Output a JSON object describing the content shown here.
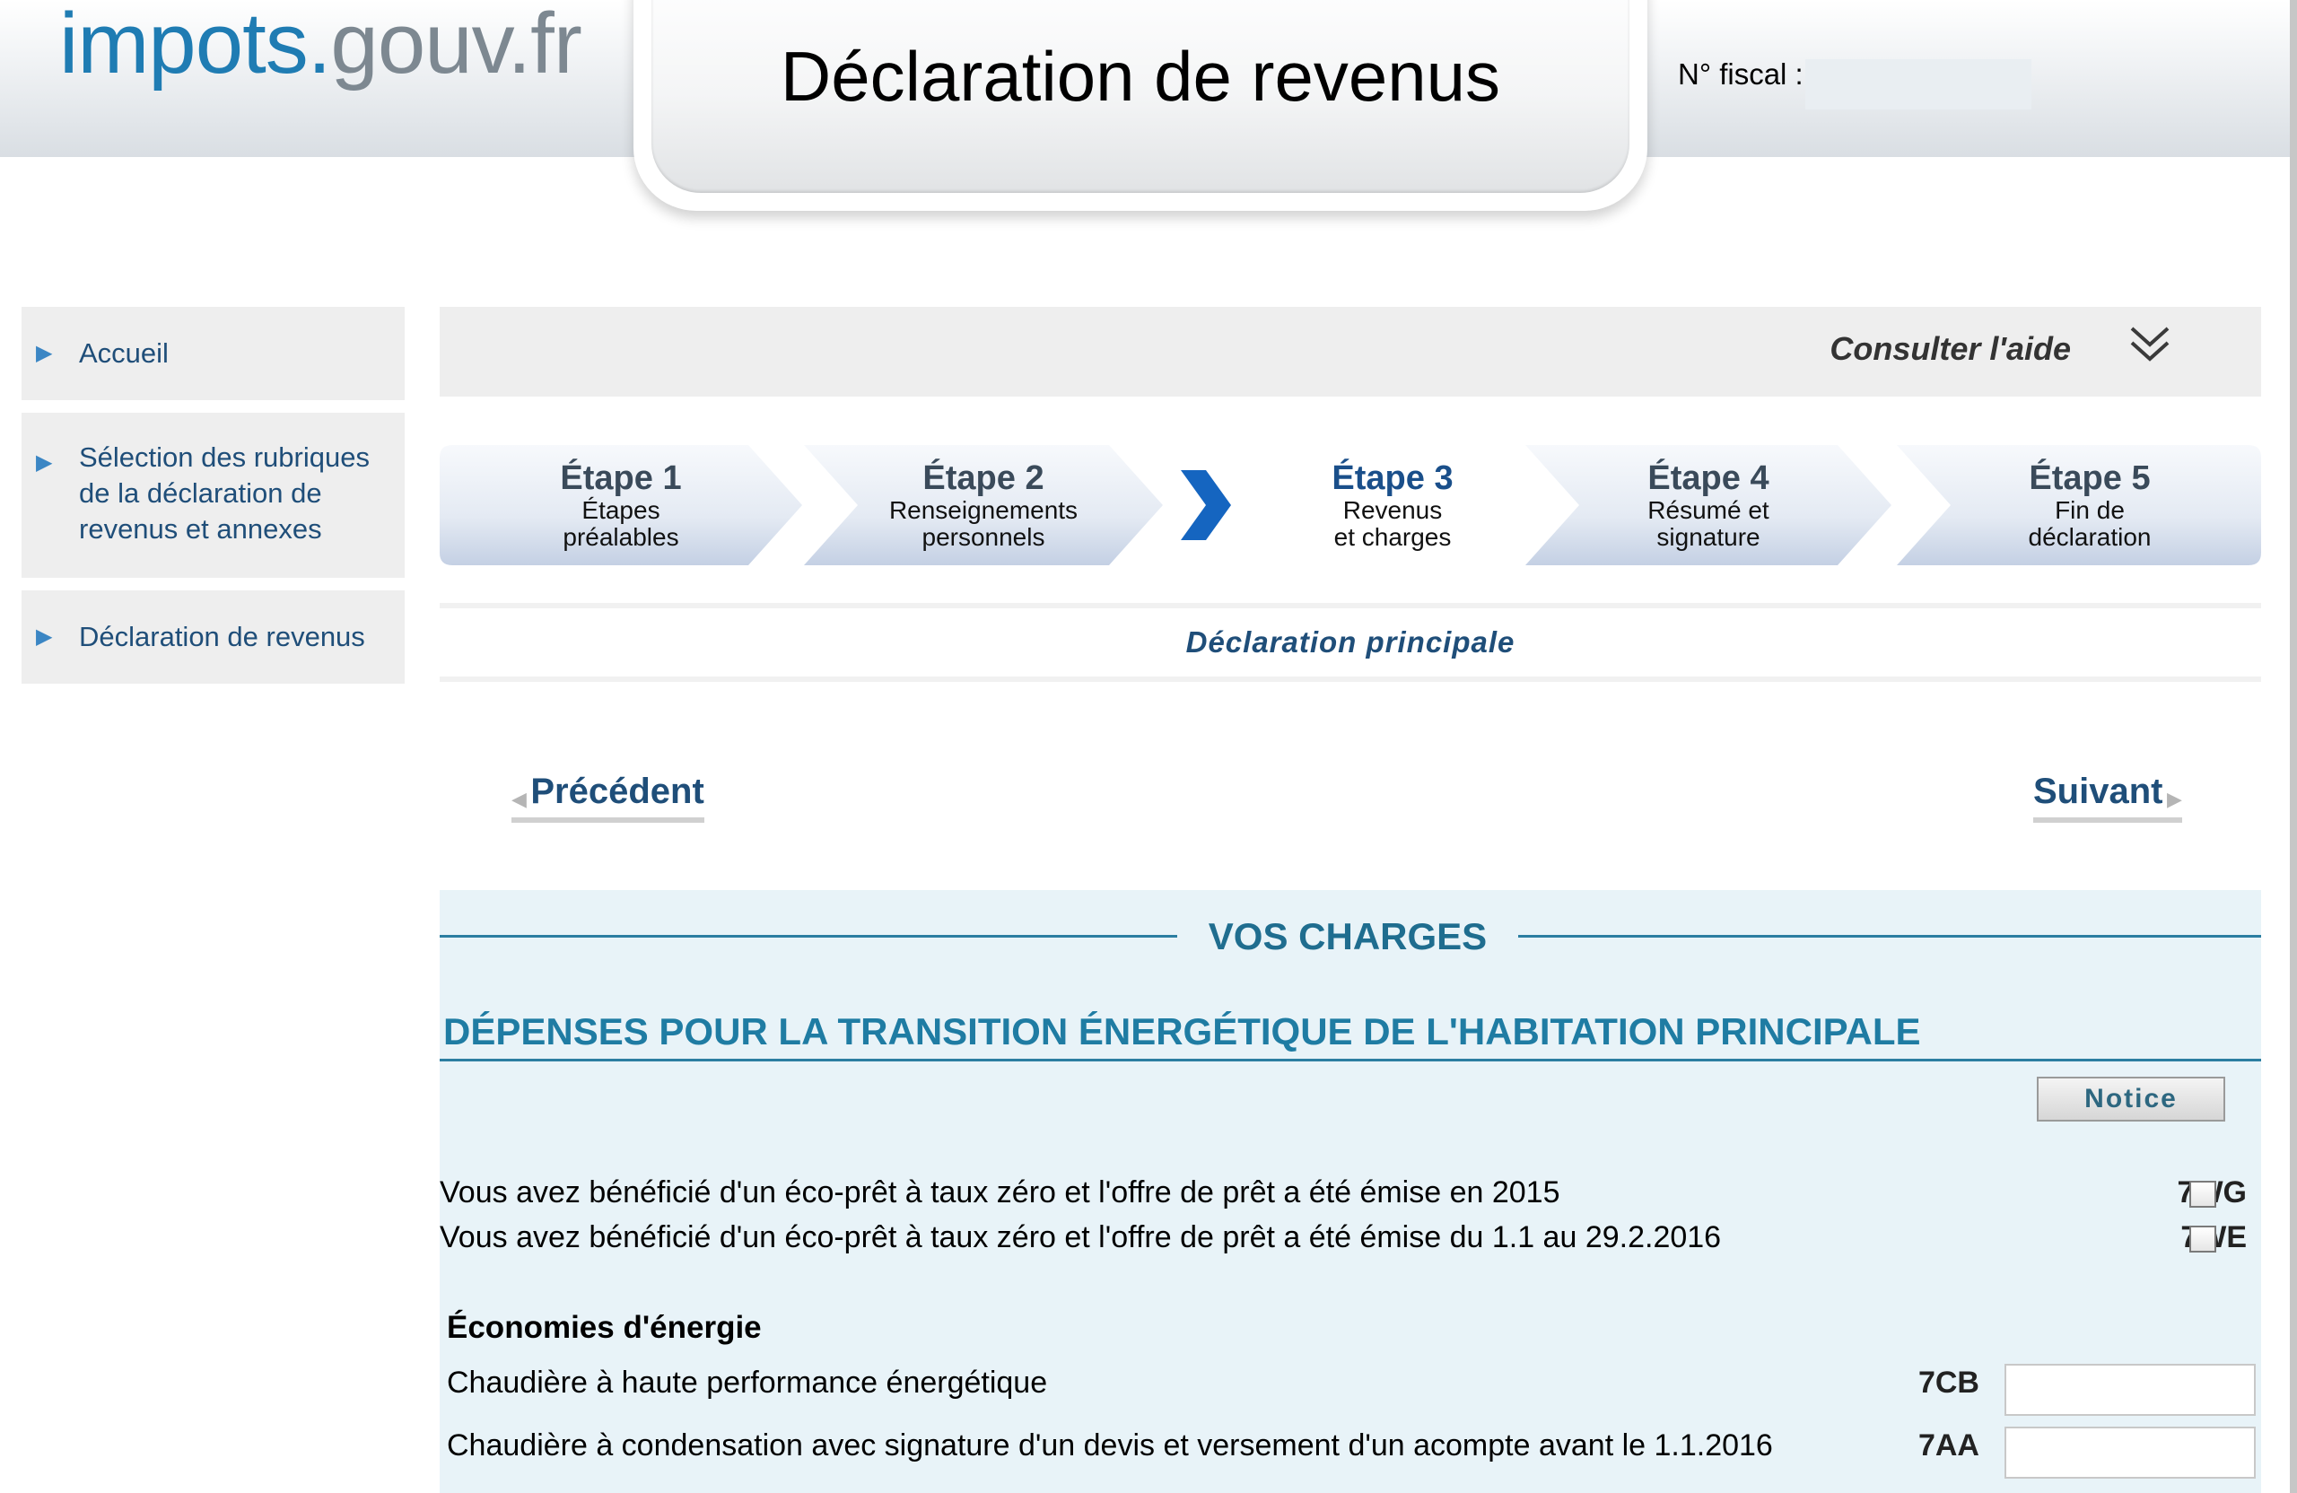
{
  "header": {
    "logo_part1": "impots.",
    "logo_part2": "gouv.fr",
    "title": "Déclaration de revenus",
    "fiscal_label": "N° fiscal :",
    "fiscal_value": ""
  },
  "sidebar": {
    "items": [
      {
        "label": "Accueil"
      },
      {
        "label": "Sélection des rubriques de la déclaration de revenus et annexes"
      },
      {
        "label": "Déclaration de revenus"
      }
    ]
  },
  "help": {
    "label": "Consulter l'aide",
    "icon": "double-chevron-down-icon"
  },
  "steps": [
    {
      "number": "Étape 1",
      "line1": "Étapes",
      "line2": "préalables",
      "active": false
    },
    {
      "number": "Étape 2",
      "line1": "Renseignements",
      "line2": "personnels",
      "active": false
    },
    {
      "number": "Étape 3",
      "line1": "Revenus",
      "line2": "et charges",
      "active": true
    },
    {
      "number": "Étape 4",
      "line1": "Résumé et",
      "line2": "signature",
      "active": false
    },
    {
      "number": "Étape 5",
      "line1": "Fin de",
      "line2": "déclaration",
      "active": false
    }
  ],
  "subheader": "Déclaration principale",
  "nav": {
    "prev": "Précédent",
    "next": "Suivant"
  },
  "section": {
    "title": "VOS CHARGES",
    "subtitle": "DÉPENSES POUR LA TRANSITION ÉNERGÉTIQUE DE L'HABITATION PRINCIPALE",
    "notice_label": "Notice",
    "checkbox_rows": [
      {
        "text": "Vous avez bénéficié d'un éco-prêt à taux zéro et l'offre de prêt a été émise en 2015",
        "code": "7WG",
        "checked": false
      },
      {
        "text": "Vous avez bénéficié d'un éco-prêt à taux zéro et l'offre de prêt a été émise du 1.1 au 29.2.2016",
        "code": "7WE",
        "checked": false
      }
    ],
    "group_title": "Économies d'énergie",
    "input_rows": [
      {
        "text": "Chaudière à haute performance énergétique",
        "code": "7CB",
        "value": ""
      },
      {
        "text": "Chaudière à condensation avec signature d'un devis et versement d'un acompte avant le 1.1.2016",
        "code": "7AA",
        "value": ""
      }
    ]
  },
  "colors": {
    "brand_blue": "#1f7cb3",
    "brand_grey": "#7d8891",
    "nav_text": "#1f4e79",
    "section_teal": "#1f7ca3",
    "form_background": "#e8f3f8",
    "active_step_chevron": "#1565c0"
  }
}
